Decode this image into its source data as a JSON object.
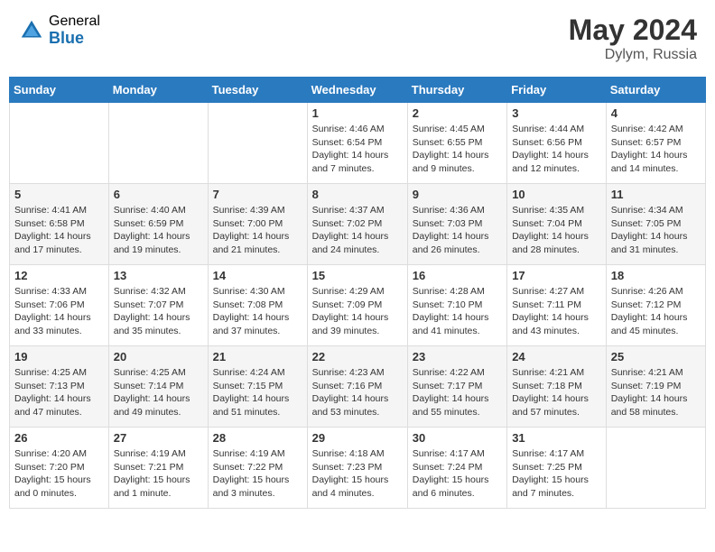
{
  "header": {
    "logo_general": "General",
    "logo_blue": "Blue",
    "month_year": "May 2024",
    "location": "Dylym, Russia"
  },
  "days_of_week": [
    "Sunday",
    "Monday",
    "Tuesday",
    "Wednesday",
    "Thursday",
    "Friday",
    "Saturday"
  ],
  "weeks": [
    [
      {
        "day": "",
        "info": ""
      },
      {
        "day": "",
        "info": ""
      },
      {
        "day": "",
        "info": ""
      },
      {
        "day": "1",
        "info": "Sunrise: 4:46 AM\nSunset: 6:54 PM\nDaylight: 14 hours\nand 7 minutes."
      },
      {
        "day": "2",
        "info": "Sunrise: 4:45 AM\nSunset: 6:55 PM\nDaylight: 14 hours\nand 9 minutes."
      },
      {
        "day": "3",
        "info": "Sunrise: 4:44 AM\nSunset: 6:56 PM\nDaylight: 14 hours\nand 12 minutes."
      },
      {
        "day": "4",
        "info": "Sunrise: 4:42 AM\nSunset: 6:57 PM\nDaylight: 14 hours\nand 14 minutes."
      }
    ],
    [
      {
        "day": "5",
        "info": "Sunrise: 4:41 AM\nSunset: 6:58 PM\nDaylight: 14 hours\nand 17 minutes."
      },
      {
        "day": "6",
        "info": "Sunrise: 4:40 AM\nSunset: 6:59 PM\nDaylight: 14 hours\nand 19 minutes."
      },
      {
        "day": "7",
        "info": "Sunrise: 4:39 AM\nSunset: 7:00 PM\nDaylight: 14 hours\nand 21 minutes."
      },
      {
        "day": "8",
        "info": "Sunrise: 4:37 AM\nSunset: 7:02 PM\nDaylight: 14 hours\nand 24 minutes."
      },
      {
        "day": "9",
        "info": "Sunrise: 4:36 AM\nSunset: 7:03 PM\nDaylight: 14 hours\nand 26 minutes."
      },
      {
        "day": "10",
        "info": "Sunrise: 4:35 AM\nSunset: 7:04 PM\nDaylight: 14 hours\nand 28 minutes."
      },
      {
        "day": "11",
        "info": "Sunrise: 4:34 AM\nSunset: 7:05 PM\nDaylight: 14 hours\nand 31 minutes."
      }
    ],
    [
      {
        "day": "12",
        "info": "Sunrise: 4:33 AM\nSunset: 7:06 PM\nDaylight: 14 hours\nand 33 minutes."
      },
      {
        "day": "13",
        "info": "Sunrise: 4:32 AM\nSunset: 7:07 PM\nDaylight: 14 hours\nand 35 minutes."
      },
      {
        "day": "14",
        "info": "Sunrise: 4:30 AM\nSunset: 7:08 PM\nDaylight: 14 hours\nand 37 minutes."
      },
      {
        "day": "15",
        "info": "Sunrise: 4:29 AM\nSunset: 7:09 PM\nDaylight: 14 hours\nand 39 minutes."
      },
      {
        "day": "16",
        "info": "Sunrise: 4:28 AM\nSunset: 7:10 PM\nDaylight: 14 hours\nand 41 minutes."
      },
      {
        "day": "17",
        "info": "Sunrise: 4:27 AM\nSunset: 7:11 PM\nDaylight: 14 hours\nand 43 minutes."
      },
      {
        "day": "18",
        "info": "Sunrise: 4:26 AM\nSunset: 7:12 PM\nDaylight: 14 hours\nand 45 minutes."
      }
    ],
    [
      {
        "day": "19",
        "info": "Sunrise: 4:25 AM\nSunset: 7:13 PM\nDaylight: 14 hours\nand 47 minutes."
      },
      {
        "day": "20",
        "info": "Sunrise: 4:25 AM\nSunset: 7:14 PM\nDaylight: 14 hours\nand 49 minutes."
      },
      {
        "day": "21",
        "info": "Sunrise: 4:24 AM\nSunset: 7:15 PM\nDaylight: 14 hours\nand 51 minutes."
      },
      {
        "day": "22",
        "info": "Sunrise: 4:23 AM\nSunset: 7:16 PM\nDaylight: 14 hours\nand 53 minutes."
      },
      {
        "day": "23",
        "info": "Sunrise: 4:22 AM\nSunset: 7:17 PM\nDaylight: 14 hours\nand 55 minutes."
      },
      {
        "day": "24",
        "info": "Sunrise: 4:21 AM\nSunset: 7:18 PM\nDaylight: 14 hours\nand 57 minutes."
      },
      {
        "day": "25",
        "info": "Sunrise: 4:21 AM\nSunset: 7:19 PM\nDaylight: 14 hours\nand 58 minutes."
      }
    ],
    [
      {
        "day": "26",
        "info": "Sunrise: 4:20 AM\nSunset: 7:20 PM\nDaylight: 15 hours\nand 0 minutes."
      },
      {
        "day": "27",
        "info": "Sunrise: 4:19 AM\nSunset: 7:21 PM\nDaylight: 15 hours\nand 1 minute."
      },
      {
        "day": "28",
        "info": "Sunrise: 4:19 AM\nSunset: 7:22 PM\nDaylight: 15 hours\nand 3 minutes."
      },
      {
        "day": "29",
        "info": "Sunrise: 4:18 AM\nSunset: 7:23 PM\nDaylight: 15 hours\nand 4 minutes."
      },
      {
        "day": "30",
        "info": "Sunrise: 4:17 AM\nSunset: 7:24 PM\nDaylight: 15 hours\nand 6 minutes."
      },
      {
        "day": "31",
        "info": "Sunrise: 4:17 AM\nSunset: 7:25 PM\nDaylight: 15 hours\nand 7 minutes."
      },
      {
        "day": "",
        "info": ""
      }
    ]
  ]
}
